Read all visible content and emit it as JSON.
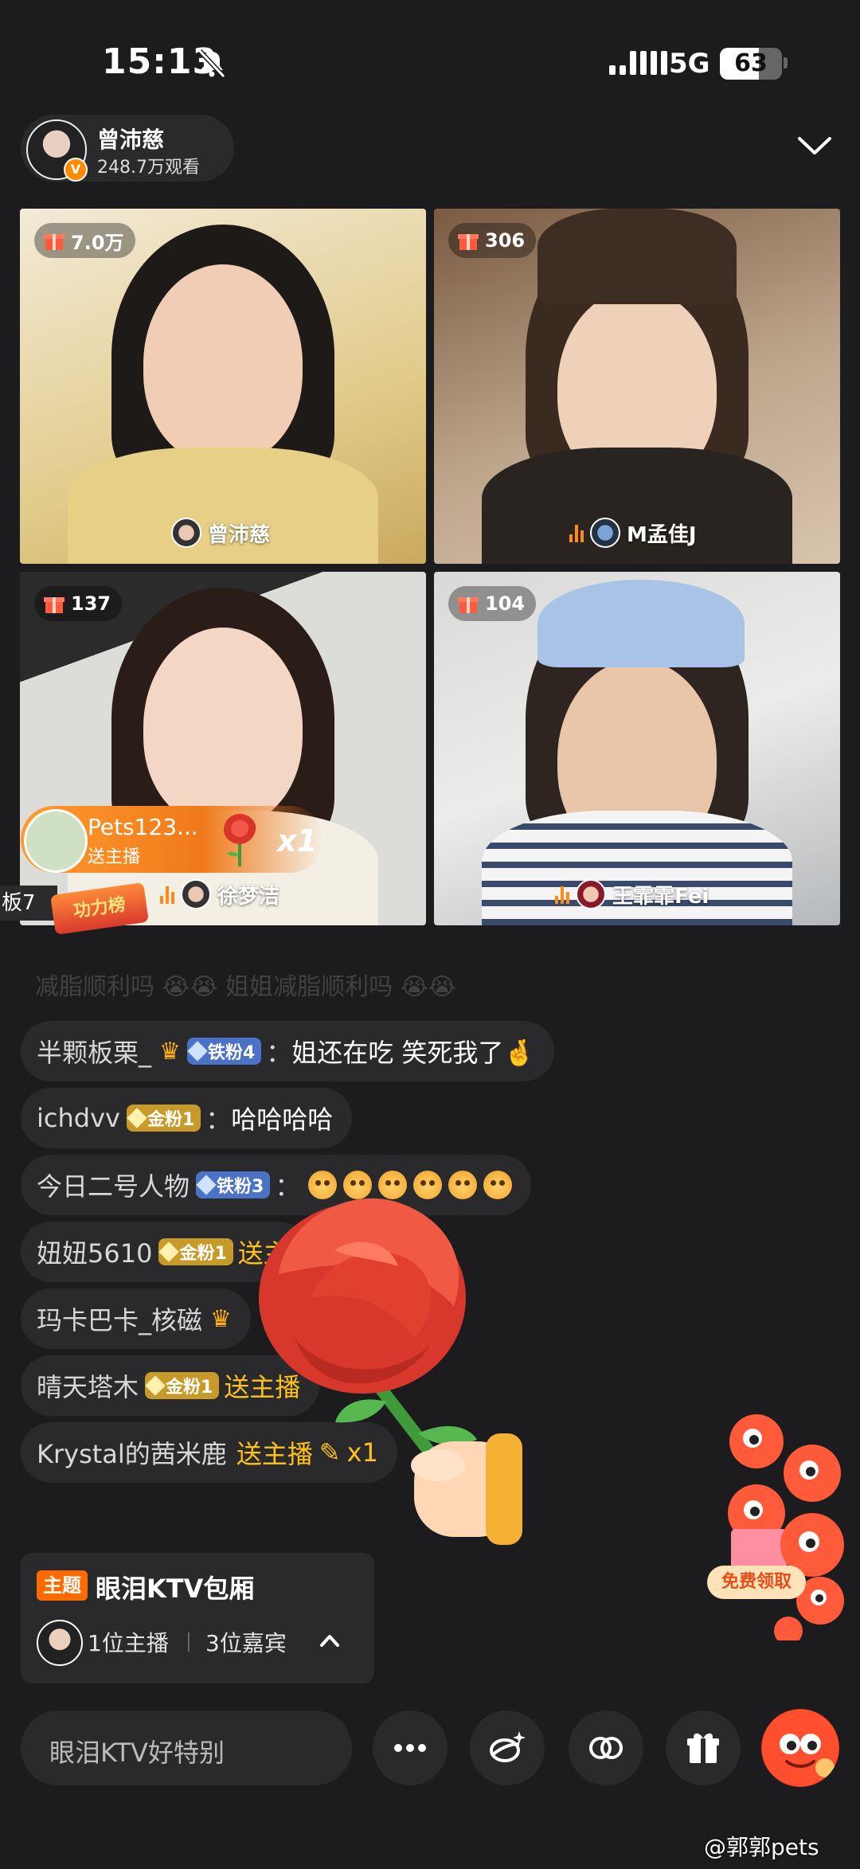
{
  "status_bar": {
    "time": "15:13",
    "network": "5G",
    "battery": "63",
    "battery_level": 0.63
  },
  "host": {
    "name": "曾沛慈",
    "viewers": "248.7万观看",
    "badge": "V"
  },
  "tiles": [
    {
      "gifts": "7.0万",
      "name": "曾沛慈"
    },
    {
      "gifts": "306",
      "name": "M孟佳J"
    },
    {
      "gifts": "137",
      "name": "徐梦洁"
    },
    {
      "gifts": "104",
      "name": "王霏霏Fei"
    }
  ],
  "gift_toast": {
    "user": "Pets123...",
    "action": "送主播",
    "count": "x1"
  },
  "side": {
    "label": "板7",
    "badge": "功力榜"
  },
  "chat": {
    "faded": "减脂顺利吗 😭😭 姐姐减脂顺利吗 😭😭",
    "messages": [
      {
        "user": "半颗板栗_",
        "fan": "铁粉4",
        "text": "姐还在吃 笑死我了🤞"
      },
      {
        "user": "ichdvv",
        "fan": "金粉1",
        "text": "哈哈哈哈"
      },
      {
        "user": "今日二号人物",
        "fan": "铁粉3",
        "text": ""
      },
      {
        "user": "妞妞5610",
        "fan": "金粉1",
        "text": "送主"
      },
      {
        "user": "玛卡巴卡_核磁",
        "text": ""
      },
      {
        "user": "晴天塔木",
        "fan": "金粉1",
        "text": "送主播"
      },
      {
        "user": "Krystal的茜米鹿",
        "text": "送主播",
        "count": "x1"
      }
    ],
    "colon": "："
  },
  "topic": {
    "tag": "主题",
    "title": "眼泪KTV包厢",
    "hosts": "1位主播",
    "guests": "3位嘉宾"
  },
  "promo": {
    "label": "免费领取"
  },
  "bottom": {
    "placeholder": "眼泪KTV好特别"
  },
  "watermark": "@郭郭pets",
  "colors": {
    "accent": "#ff8a00",
    "gift_text": "#ffc21a",
    "iron_fan": "#4b72c6",
    "gold_fan": "#c89a2a",
    "background": "#1c1c1e"
  }
}
